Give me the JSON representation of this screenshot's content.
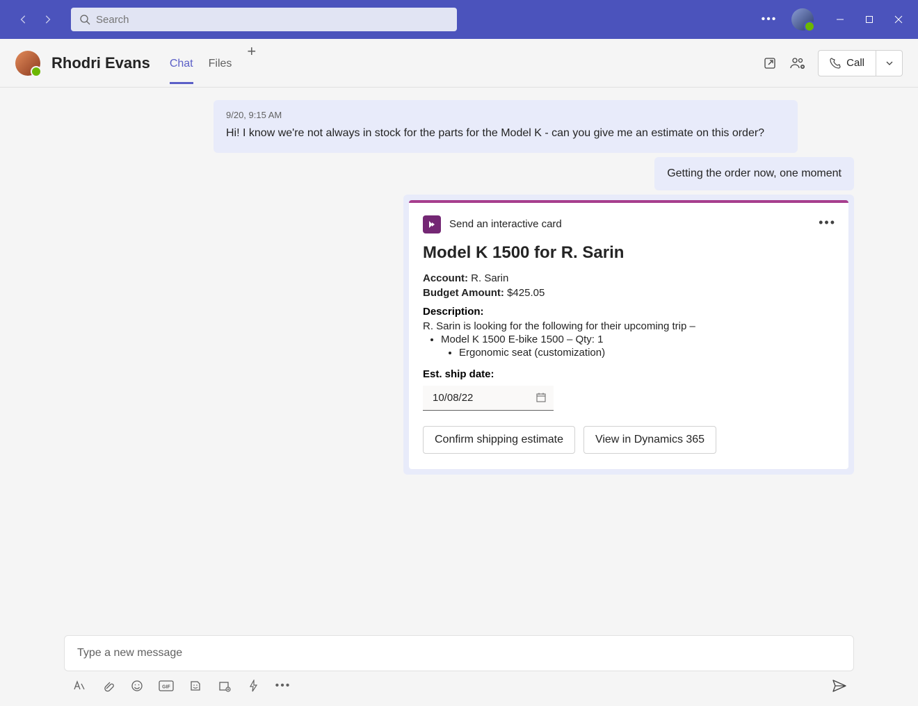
{
  "titlebar": {
    "search_placeholder": "Search"
  },
  "chat": {
    "peer_name": "Rhodri Evans",
    "tabs": [
      "Chat",
      "Files"
    ],
    "call_label": "Call"
  },
  "messages": {
    "incoming_ts": "9/20, 9:15 AM",
    "incoming_text": "Hi! I know we're not always in stock for the parts for the Model K - can you give me an estimate on this order?",
    "outgoing_text": "Getting the order now, one moment"
  },
  "card": {
    "app_header": "Send an interactive card",
    "title": "Model K 1500 for R. Sarin",
    "account_label": "Account:",
    "account_value": " R. Sarin",
    "budget_label": "Budget Amount:",
    "budget_value": " $425.05",
    "description_label": "Description:",
    "description_text": "R. Sarin is looking for the following for their upcoming trip –",
    "item1": "Model K 1500 E-bike 1500 – Qty: 1",
    "item2": "Ergonomic seat (customization)",
    "ship_date_label": "Est. ship date:",
    "ship_date_value": "10/08/22",
    "btn_confirm": "Confirm shipping estimate",
    "btn_view": "View in Dynamics 365"
  },
  "compose": {
    "placeholder": "Type a new message"
  }
}
